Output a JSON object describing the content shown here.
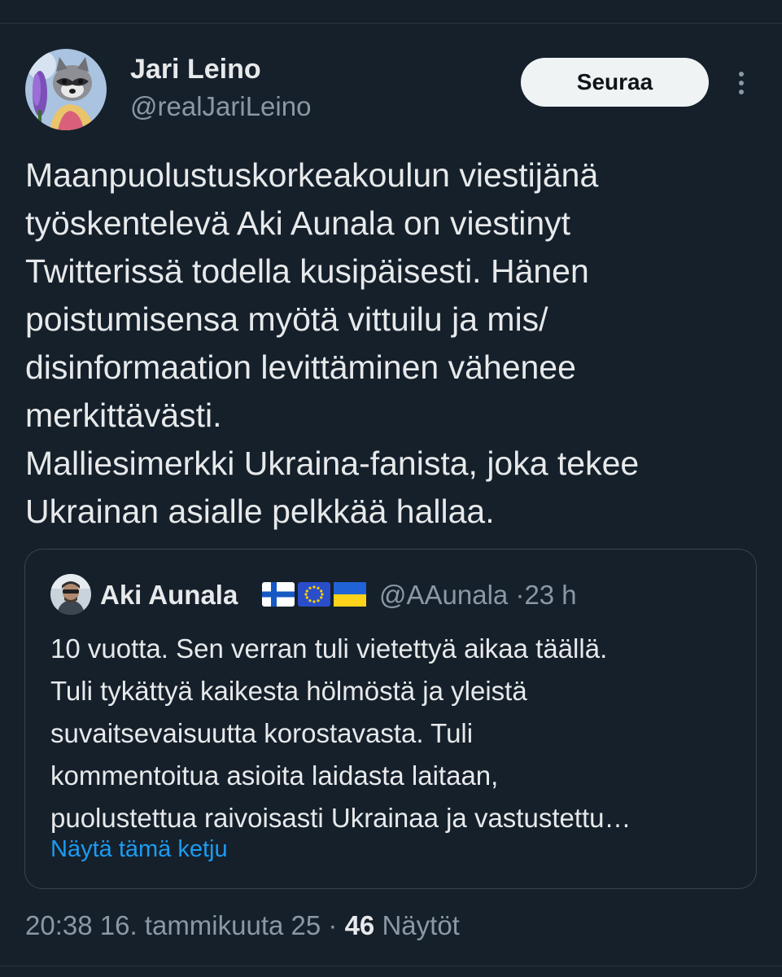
{
  "author": {
    "name": "Jari Leino",
    "handle": "@realJariLeino"
  },
  "follow_button_label": "Seuraa",
  "tweet": {
    "lines": [
      "Maanpuolustuskorkeakoulun viestijänä",
      "työskentelevä Aki Aunala on viestinyt",
      "Twitterissä todella kusipäisesti. Hänen",
      "poistumisensa myötä vittuilu ja mis/",
      "disinformaation levittäminen vähenee",
      "merkittävästi.",
      "Malliesimerkki Ukraina-fanista, joka tekee",
      "Ukrainan asialle pelkkää hallaa."
    ]
  },
  "quote": {
    "name": "Aki Aunala",
    "flags": [
      "finland-flag",
      "eu-flag",
      "ukraine-flag"
    ],
    "handle": "@AAunala",
    "separator": "·",
    "time": "23 h",
    "lines": [
      "10 vuotta. Sen verran tuli vietettyä aikaa täällä.",
      "Tuli tykättyä kaikesta hölmöstä ja yleistä",
      "suvaitsevaisuutta korostavasta. Tuli",
      "kommentoitua asioita laidasta laitaan,",
      "puolustettua raivoisasti Ukrainaa ja vastustettu…"
    ],
    "show_thread_label": "Näytä tämä ketju"
  },
  "footer": {
    "timestamp": "20:38 16. tammikuuta 25",
    "separator": "·",
    "views_count": "46",
    "views_label": "Näytöt"
  },
  "colors": {
    "background": "#15202b",
    "text": "#e7e9ea",
    "muted": "#8b98a5",
    "link": "#1d9bf0",
    "border": "#38444d"
  }
}
